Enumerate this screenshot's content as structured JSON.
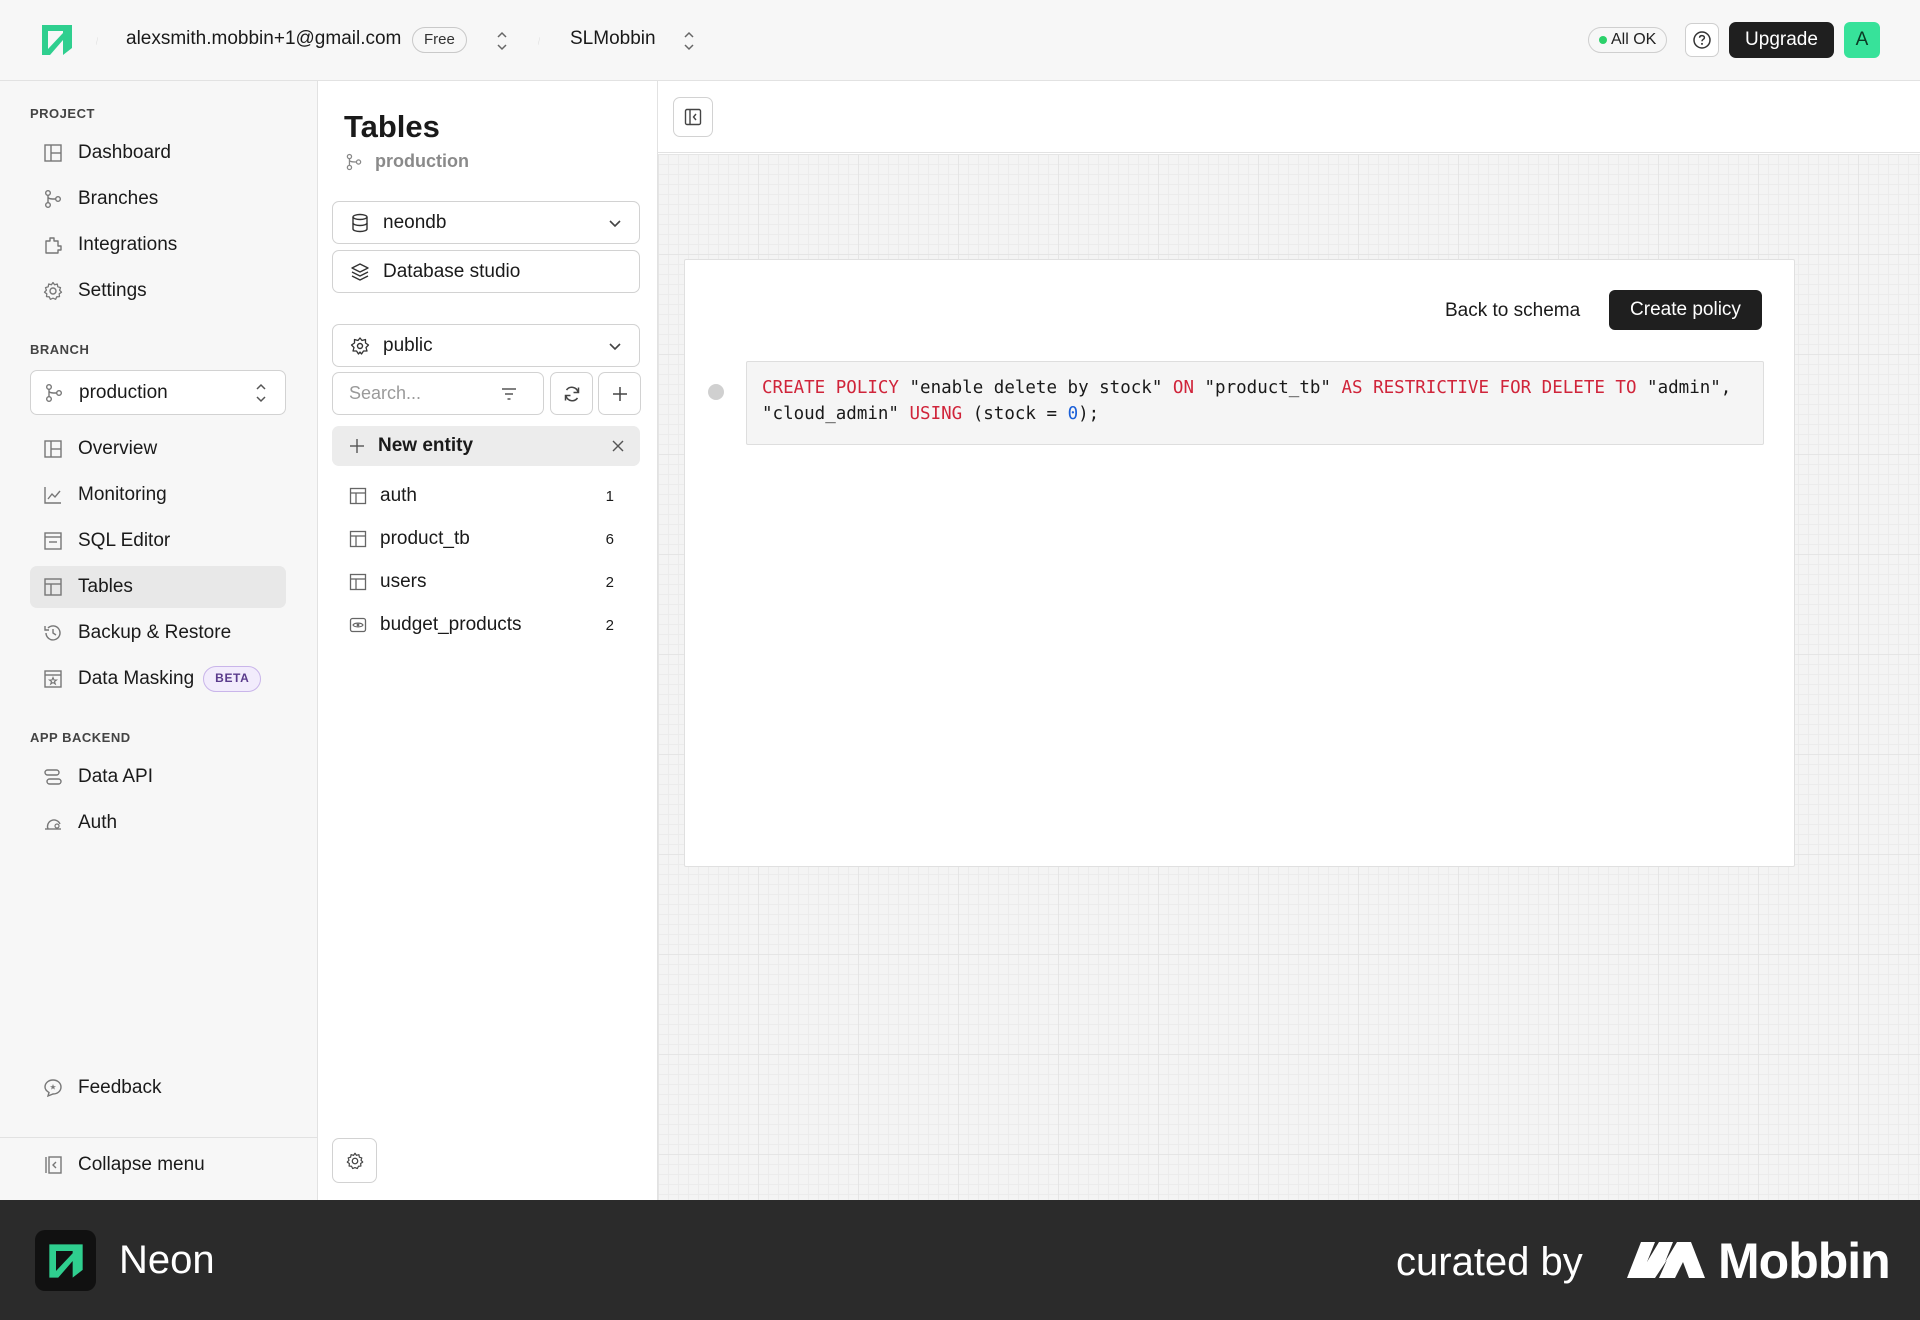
{
  "topbar": {
    "account_email": "alexsmith.mobbin+1@gmail.com",
    "plan_badge": "Free",
    "project_name": "SLMobbin",
    "status_label": "All OK",
    "upgrade_label": "Upgrade",
    "avatar_initial": "A"
  },
  "sidebar": {
    "project_section": "PROJECT",
    "project_items": [
      {
        "label": "Dashboard",
        "icon": "dashboard-icon"
      },
      {
        "label": "Branches",
        "icon": "branches-icon"
      },
      {
        "label": "Integrations",
        "icon": "integrations-icon"
      },
      {
        "label": "Settings",
        "icon": "gear-icon"
      }
    ],
    "branch_section": "BRANCH",
    "branch_selected": "production",
    "branch_items": [
      {
        "label": "Overview",
        "icon": "overview-icon"
      },
      {
        "label": "Monitoring",
        "icon": "chart-icon"
      },
      {
        "label": "SQL Editor",
        "icon": "terminal-icon"
      },
      {
        "label": "Tables",
        "icon": "table-icon",
        "active": true
      },
      {
        "label": "Backup & Restore",
        "icon": "history-icon"
      },
      {
        "label": "Data Masking",
        "icon": "mask-icon",
        "badge": "BETA"
      }
    ],
    "backend_section": "APP BACKEND",
    "backend_items": [
      {
        "label": "Data API",
        "icon": "api-icon"
      },
      {
        "label": "Auth",
        "icon": "auth-icon"
      }
    ],
    "feedback_label": "Feedback",
    "collapse_label": "Collapse menu"
  },
  "tables_panel": {
    "title": "Tables",
    "branch": "production",
    "database": "neondb",
    "studio_label": "Database studio",
    "schema": "public",
    "search_placeholder": "Search...",
    "new_entity_label": "New entity",
    "entities": [
      {
        "name": "auth",
        "count": "1",
        "icon": "table-icon"
      },
      {
        "name": "product_tb",
        "count": "6",
        "icon": "table-icon"
      },
      {
        "name": "users",
        "count": "2",
        "icon": "table-icon"
      },
      {
        "name": "budget_products",
        "count": "2",
        "icon": "view-icon"
      }
    ]
  },
  "policy_editor": {
    "back_label": "Back to schema",
    "create_label": "Create policy",
    "sql_tokens": {
      "kw_create_policy": "CREATE POLICY",
      "policy_name": " \"enable delete by stock\" ",
      "kw_on": "ON",
      "table_name": " \"product_tb\" ",
      "kw_as_restrictive": "AS RESTRICTIVE FOR DELETE TO",
      "role_admin": " \"admin\",",
      "role_cloud_admin": "\"cloud_admin\" ",
      "kw_using": "USING",
      "cond_start": " (stock = ",
      "cond_value": "0",
      "cond_end": ");"
    }
  },
  "footer": {
    "app_name": "Neon",
    "curated_by": "curated by",
    "brand": "Mobbin"
  },
  "colors": {
    "accent_green": "#37e29a",
    "keyword_red": "#d0243a",
    "number_blue": "#1a5fd8",
    "status_green": "#2bd16a",
    "footer_bg": "#2b2b2b"
  }
}
